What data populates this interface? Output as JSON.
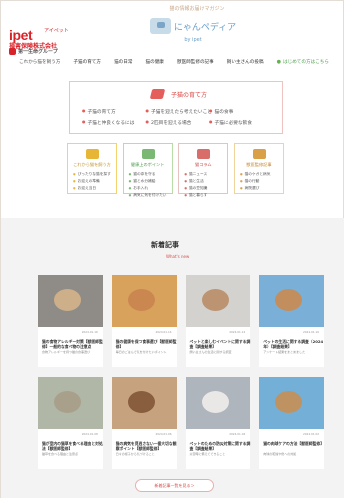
{
  "brand": {
    "name": "ipet",
    "kana": "アイペット",
    "subtitle": "損害保険株式会社",
    "group": "第一生命グループ"
  },
  "logo": {
    "tagline": "猫の情報お届けマガジン",
    "title": "にゃんペディア",
    "by": "by ipet"
  },
  "nav": [
    "これから猫を飼う方",
    "子猫の育て方",
    "猫の日常",
    "猫の健康",
    "獣医師監修の記事",
    "飼い主さんの投稿",
    "はじめての方はこちら"
  ],
  "hero": {
    "title": "子猫の育て方",
    "items": [
      "子猫の育て方",
      "子猫を迎えたら考えたいこと",
      "猫の食事",
      "子猫と仲良くなるには",
      "2匹目を迎える場合",
      "子猫に必要な飲食"
    ]
  },
  "cards": [
    {
      "title": "これから猫を飼う方",
      "items": [
        "ぴったりな猫を探す",
        "お迎えの準備",
        "お迎え当日"
      ]
    },
    {
      "title": "健康上のポイント",
      "items": [
        "猫の命を守る",
        "猫と水分補給",
        "お手入れ",
        "病気に気を付けたい"
      ]
    },
    {
      "title": "猫コラム",
      "items": [
        "猫ニュース",
        "猫と生活",
        "猫の豆知識",
        "猫と暮らす"
      ]
    },
    {
      "title": "獣医監修記事",
      "items": [
        "猫のケガと病気",
        "猫の行動",
        "病院選び"
      ]
    }
  ],
  "latest": {
    "title": "新着記事",
    "subtitle": "What's new",
    "more": "新着記事一覧を見る＞"
  },
  "posts": [
    {
      "title": "猫の食物アレルギー対策【獣医師監修】一般的な食べ物の注意点",
      "date": "2024.01.16",
      "desc": "食物アレルギーを持つ猫の食事選び"
    },
    {
      "title": "猫の健康を保つ食事選び【獣医師監修】",
      "date": "2024.01.14",
      "desc": "毎日のごはんで気を付けたいポイント"
    },
    {
      "title": "ペットと楽しむイベントに関する調査【調査結果】",
      "date": "2024.01.12",
      "desc": "飼い主さんの生活に関する調査"
    },
    {
      "title": "ペットの生活に関する調査（2024年）【調査結果】",
      "date": "2024.01.10",
      "desc": "アンケート結果をまとめました"
    },
    {
      "title": "猫が室内の猫草を食べる理由と対処法【獣医師監修】",
      "date": "2024.01.08",
      "desc": "猫草を食べる理由と注意点"
    },
    {
      "title": "猫の病気を見逃さない一番大切な観察ポイント【獣医師監修】",
      "date": "2024.01.06",
      "desc": "日々の様子から気づけること"
    },
    {
      "title": "ペットのための防災対策に関する調査【調査結果】",
      "date": "2024.01.04",
      "desc": "災害時に備えてできること"
    },
    {
      "title": "猫の肉球ケアの方法【獣医師監修】",
      "date": "2024.01.02",
      "desc": "肉球の乾燥や傷への対処"
    }
  ]
}
